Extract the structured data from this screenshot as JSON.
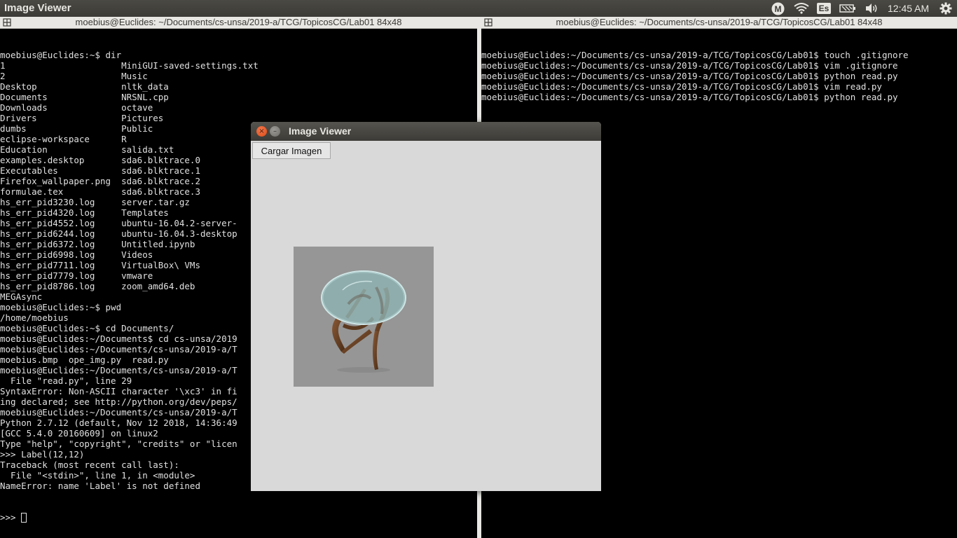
{
  "topbar": {
    "app_title": "Image Viewer",
    "indicators": [
      "mega-icon",
      "wifi-icon",
      "keyboard-layout-icon",
      "battery-icon",
      "volume-icon",
      "gear-icon"
    ],
    "keyboard_layout": "Es",
    "mega_label": "M",
    "clock": "12:45 AM"
  },
  "left_terminal": {
    "title": "moebius@Euclides: ~/Documents/cs-unsa/2019-a/TCG/TopicosCG/Lab01 84x48",
    "lines": [
      "moebius@Euclides:~$ dir",
      "1                      MiniGUI-saved-settings.txt",
      "2                      Music",
      "Desktop                nltk_data",
      "Documents              NRSNL.cpp",
      "Downloads              octave",
      "Drivers                Pictures",
      "dumbs                  Public",
      "eclipse-workspace      R",
      "Education              salida.txt",
      "examples.desktop       sda6.blktrace.0",
      "Executables            sda6.blktrace.1",
      "Firefox_wallpaper.png  sda6.blktrace.2",
      "formulae.tex           sda6.blktrace.3",
      "hs_err_pid3230.log     server.tar.gz",
      "hs_err_pid4320.log     Templates",
      "hs_err_pid4552.log     ubuntu-16.04.2-server-",
      "hs_err_pid6244.log     ubuntu-16.04.3-desktop",
      "hs_err_pid6372.log     Untitled.ipynb",
      "hs_err_pid6998.log     Videos",
      "hs_err_pid7711.log     VirtualBox\\ VMs",
      "hs_err_pid7779.log     vmware",
      "hs_err_pid8786.log     zoom_amd64.deb",
      "MEGAsync",
      "moebius@Euclides:~$ pwd",
      "/home/moebius",
      "moebius@Euclides:~$ cd Documents/",
      "moebius@Euclides:~/Documents$ cd cs-unsa/2019",
      "moebius@Euclides:~/Documents/cs-unsa/2019-a/T",
      "moebius.bmp  ope_img.py  read.py",
      "moebius@Euclides:~/Documents/cs-unsa/2019-a/T",
      "  File \"read.py\", line 29",
      "SyntaxError: Non-ASCII character '\\xc3' in fi",
      "ing declared; see http://python.org/dev/peps/",
      "moebius@Euclides:~/Documents/cs-unsa/2019-a/T",
      "Python 2.7.12 (default, Nov 12 2018, 14:36:49",
      "[GCC 5.4.0 20160609] on linux2",
      "Type \"help\", \"copyright\", \"credits\" or \"licen",
      ">>> Label(12,12)",
      "Traceback (most recent call last):",
      "  File \"<stdin>\", line 1, in <module>",
      "NameError: name 'Label' is not defined"
    ],
    "prompt": ">>> "
  },
  "right_terminal": {
    "title": "moebius@Euclides: ~/Documents/cs-unsa/2019-a/TCG/TopicosCG/Lab01 84x48",
    "lines": [
      "moebius@Euclides:~/Documents/cs-unsa/2019-a/TCG/TopicosCG/Lab01$ touch .gitignore",
      "moebius@Euclides:~/Documents/cs-unsa/2019-a/TCG/TopicosCG/Lab01$ vim .gitignore",
      "moebius@Euclides:~/Documents/cs-unsa/2019-a/TCG/TopicosCG/Lab01$ python read.py",
      "moebius@Euclides:~/Documents/cs-unsa/2019-a/TCG/TopicosCG/Lab01$ vim read.py",
      "moebius@Euclides:~/Documents/cs-unsa/2019-a/TCG/TopicosCG/Lab01$ python read.py"
    ]
  },
  "viewer": {
    "title": "Image Viewer",
    "close_glyph": "×",
    "minimize_glyph": "–",
    "load_button": "Cargar Imagen",
    "image_icon": "glass-table-image"
  }
}
